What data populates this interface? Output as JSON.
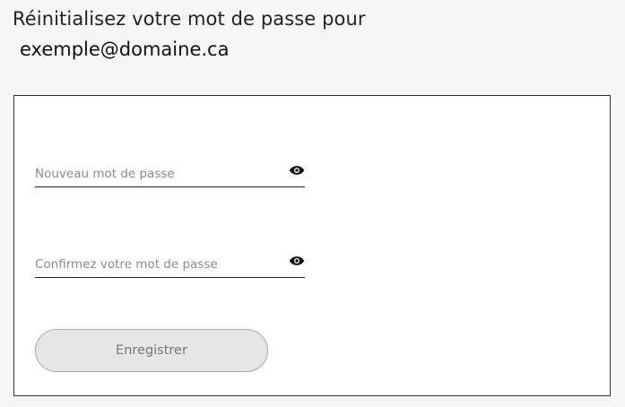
{
  "header": {
    "title": "Réinitialisez votre mot de passe pour",
    "email": "exemple@domaine.ca"
  },
  "form": {
    "new_password": {
      "placeholder": "Nouveau mot de passe",
      "icon": "eye-icon"
    },
    "confirm_password": {
      "placeholder": "Confirmez votre mot de passe",
      "icon": "eye-icon"
    },
    "submit_label": "Enregistrer"
  },
  "colors": {
    "background": "#f7f7f5",
    "card": "#ffffff",
    "placeholder": "#8a8a8a",
    "button_bg": "#e6e6e6",
    "button_text": "#777777"
  }
}
